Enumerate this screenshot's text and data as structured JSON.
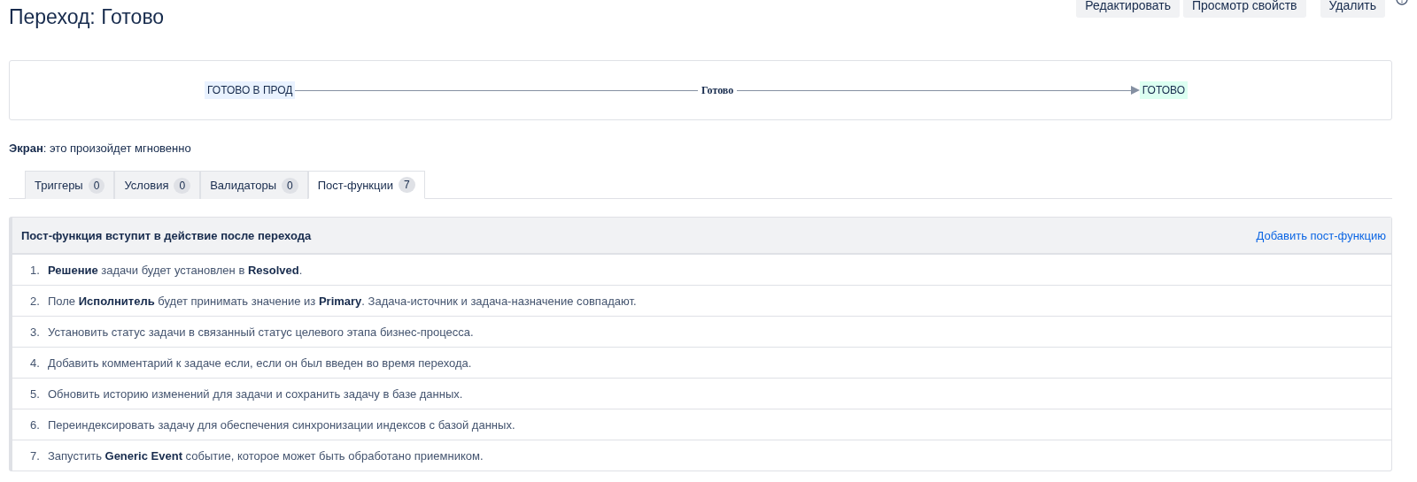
{
  "title": "Переход: Готово",
  "actions": [
    {
      "label": "Редактировать"
    },
    {
      "label": "Просмотр свойств"
    },
    {
      "label": "Удалить"
    }
  ],
  "diagram": {
    "nodes": [
      {
        "kind": "status",
        "label": "ГОТОВО В ПРОД",
        "color": "#e9f2ff"
      },
      {
        "kind": "transition",
        "label": "Готово"
      },
      {
        "kind": "status",
        "label": "ГОТОВО",
        "color": "#dcfff1"
      }
    ]
  },
  "screen": "**Экран**: это произойдет мгновенно",
  "tabs": [
    {
      "label": "Триггеры",
      "count": "0",
      "selected": false
    },
    {
      "label": "Условия",
      "count": "0",
      "selected": false
    },
    {
      "label": "Валидаторы",
      "count": "0",
      "selected": false
    },
    {
      "label": "Пост-функции",
      "count": "7",
      "selected": true
    }
  ],
  "panel": {
    "heading": "Пост-функция вступит в действие после перехода",
    "link": "Добавить пост-функцию",
    "items": [
      {
        "number": "1.",
        "text": "**Решение** задачи будет установлен в **Resolved**."
      },
      {
        "number": "2.",
        "text": "Поле **Исполнитель** будет принимать значение из **Primary**. Задача-источник и задача-назначение совпадают."
      },
      {
        "number": "3.",
        "text": "Установить статус задачи в связанный статус целевого этапа бизнес-процесса."
      },
      {
        "number": "4.",
        "text": "Добавить комментарий к задаче если, если он был введен во время перехода."
      },
      {
        "number": "5.",
        "text": "Обновить историю изменений для задачи и сохранить задачу в базе данных."
      },
      {
        "number": "6.",
        "text": "Переиндексировать задачу для обеспечения синхронизации индексов с базой данных."
      },
      {
        "number": "7.",
        "text": "Запустить **Generic Event** событие, которое может быть обработано приемником."
      }
    ]
  }
}
